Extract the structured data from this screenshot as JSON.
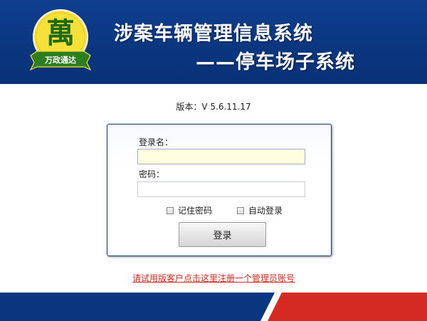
{
  "header": {
    "logo_text": "萬",
    "logo_subtitle": "万政通达",
    "title_line1": "涉案车辆管理信息系统",
    "title_line2": "——停车场子系统"
  },
  "version_text": "版本：V 5.6.11.17",
  "login": {
    "username_label": "登录名：",
    "username_value": "",
    "password_label": "密码：",
    "password_value": "",
    "remember_label": "记住密码",
    "autologin_label": "自动登录",
    "remember_checked": false,
    "autologin_checked": false,
    "submit_label": "登录"
  },
  "register_link": "请试用版客户点击这里注册一个管理员账号",
  "colors": {
    "header_blue": "#0a367f",
    "footer_red": "#d52a22",
    "link_red": "#e0261b",
    "logo_yellow": "#f7e23a",
    "logo_green": "#2e7d1f"
  }
}
